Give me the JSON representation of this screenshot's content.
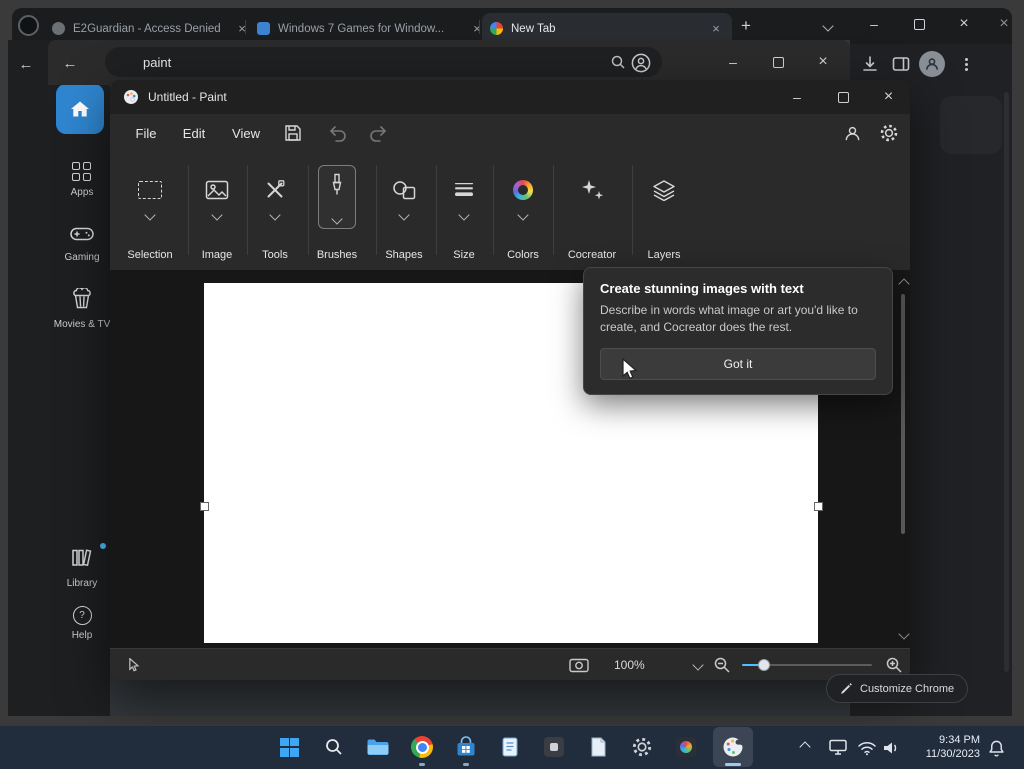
{
  "browser": {
    "tabs": [
      {
        "title": "E2Guardian - Access Denied"
      },
      {
        "title": "Windows 7 Games for Window..."
      },
      {
        "title": "New Tab"
      }
    ],
    "address": "paint"
  },
  "glyphs": {
    "close": "×",
    "minimize": "–",
    "new_tab": "+",
    "back": "←",
    "help": "?"
  },
  "store": {
    "nav_items": [
      {
        "label": "Apps"
      },
      {
        "label": "Gaming"
      },
      {
        "label": "Movies & TV"
      },
      {
        "label": "Library"
      },
      {
        "label": "Help"
      }
    ]
  },
  "paint": {
    "title": "Untitled - Paint",
    "menus": [
      {
        "label": "File"
      },
      {
        "label": "Edit"
      },
      {
        "label": "View"
      }
    ],
    "tools": [
      {
        "label": "Selection"
      },
      {
        "label": "Image"
      },
      {
        "label": "Tools"
      },
      {
        "label": "Brushes"
      },
      {
        "label": "Shapes"
      },
      {
        "label": "Size"
      },
      {
        "label": "Colors"
      },
      {
        "label": "Cocreator"
      },
      {
        "label": "Layers"
      }
    ],
    "cocreator_tooltip": {
      "title": "Create stunning images with text",
      "body": "Describe in words what image or art you'd like to create, and Cocreator does the rest.",
      "dismiss_label": "Got it"
    },
    "status": {
      "zoom": "100%"
    }
  },
  "new_tab_page": {
    "customize_button": "Customize Chrome"
  },
  "taskbar": {
    "time": "9:34 PM",
    "date": "11/30/2023"
  },
  "colors": {
    "accent_blue": "#4cc2ff",
    "home_tile_blue": "#2f86d0",
    "canvas_white": "#ffffff"
  }
}
